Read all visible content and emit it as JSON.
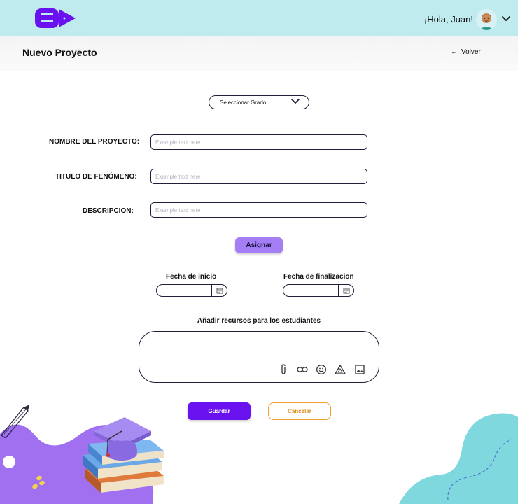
{
  "header": {
    "greeting": "¡Hola, Juan!",
    "brand_color": "#6a11f0",
    "background": "#bfeaee"
  },
  "subheader": {
    "title": "Nuevo Proyecto",
    "back_label": "Volver"
  },
  "form": {
    "grade_select": {
      "value": "Seleccionar Grado"
    },
    "fields": [
      {
        "label": "NOMBRE DEL PROYECTO:",
        "placeholder": "Example text here"
      },
      {
        "label": "TITULO DE FENÓMENO:",
        "placeholder": "Example text here"
      },
      {
        "label": "DESCRIPCION:",
        "placeholder": "Example text here"
      }
    ],
    "assign_label": "Asignar",
    "start_date_label": "Fecha de inicio",
    "end_date_label": "Fecha de finalizacion",
    "resources_label": "Añadir recursos para los estudiantes",
    "resource_tools": [
      "paperclip-icon",
      "link-icon",
      "emoji-icon",
      "drive-icon",
      "image-icon"
    ],
    "save_label": "Guardar",
    "cancel_label": "Cancelar"
  },
  "colors": {
    "accent": "#a47ef5",
    "primary": "#6a11f0",
    "cancel": "#f0a030",
    "teal_blob": "#7ed8de",
    "purple_blob": "#a070f0"
  }
}
